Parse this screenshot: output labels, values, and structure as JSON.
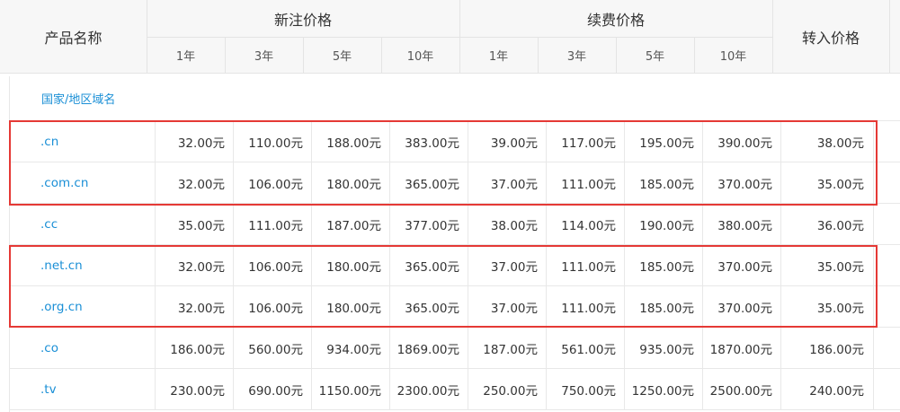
{
  "header": {
    "product_name": "产品名称",
    "new_price": "新注价格",
    "renew_price": "续费价格",
    "transfer_price": "转入价格",
    "new_years": [
      "1年",
      "3年",
      "5年",
      "10年"
    ],
    "renew_years": [
      "1年",
      "3年",
      "5年",
      "10年"
    ]
  },
  "region_label": "国家/地区域名",
  "rows": [
    {
      "name": ".cn",
      "new": [
        "32.00元",
        "110.00元",
        "188.00元",
        "383.00元"
      ],
      "renew": [
        "39.00元",
        "117.00元",
        "195.00元",
        "390.00元"
      ],
      "transfer": "38.00元"
    },
    {
      "name": ".com.cn",
      "new": [
        "32.00元",
        "106.00元",
        "180.00元",
        "365.00元"
      ],
      "renew": [
        "37.00元",
        "111.00元",
        "185.00元",
        "370.00元"
      ],
      "transfer": "35.00元"
    },
    {
      "name": ".cc",
      "new": [
        "35.00元",
        "111.00元",
        "187.00元",
        "377.00元"
      ],
      "renew": [
        "38.00元",
        "114.00元",
        "190.00元",
        "380.00元"
      ],
      "transfer": "36.00元"
    },
    {
      "name": ".net.cn",
      "new": [
        "32.00元",
        "106.00元",
        "180.00元",
        "365.00元"
      ],
      "renew": [
        "37.00元",
        "111.00元",
        "185.00元",
        "370.00元"
      ],
      "transfer": "35.00元"
    },
    {
      "name": ".org.cn",
      "new": [
        "32.00元",
        "106.00元",
        "180.00元",
        "365.00元"
      ],
      "renew": [
        "37.00元",
        "111.00元",
        "185.00元",
        "370.00元"
      ],
      "transfer": "35.00元"
    },
    {
      "name": ".co",
      "new": [
        "186.00元",
        "560.00元",
        "934.00元",
        "1869.00元"
      ],
      "renew": [
        "187.00元",
        "561.00元",
        "935.00元",
        "1870.00元"
      ],
      "transfer": "186.00元"
    },
    {
      "name": ".tv",
      "new": [
        "230.00元",
        "690.00元",
        "1150.00元",
        "2300.00元"
      ],
      "renew": [
        "250.00元",
        "750.00元",
        "1250.00元",
        "2500.00元"
      ],
      "transfer": "240.00元"
    }
  ],
  "colors": {
    "link": "#1a8fd6",
    "highlight": "#e53935",
    "header_bg": "#f7f7f7"
  }
}
